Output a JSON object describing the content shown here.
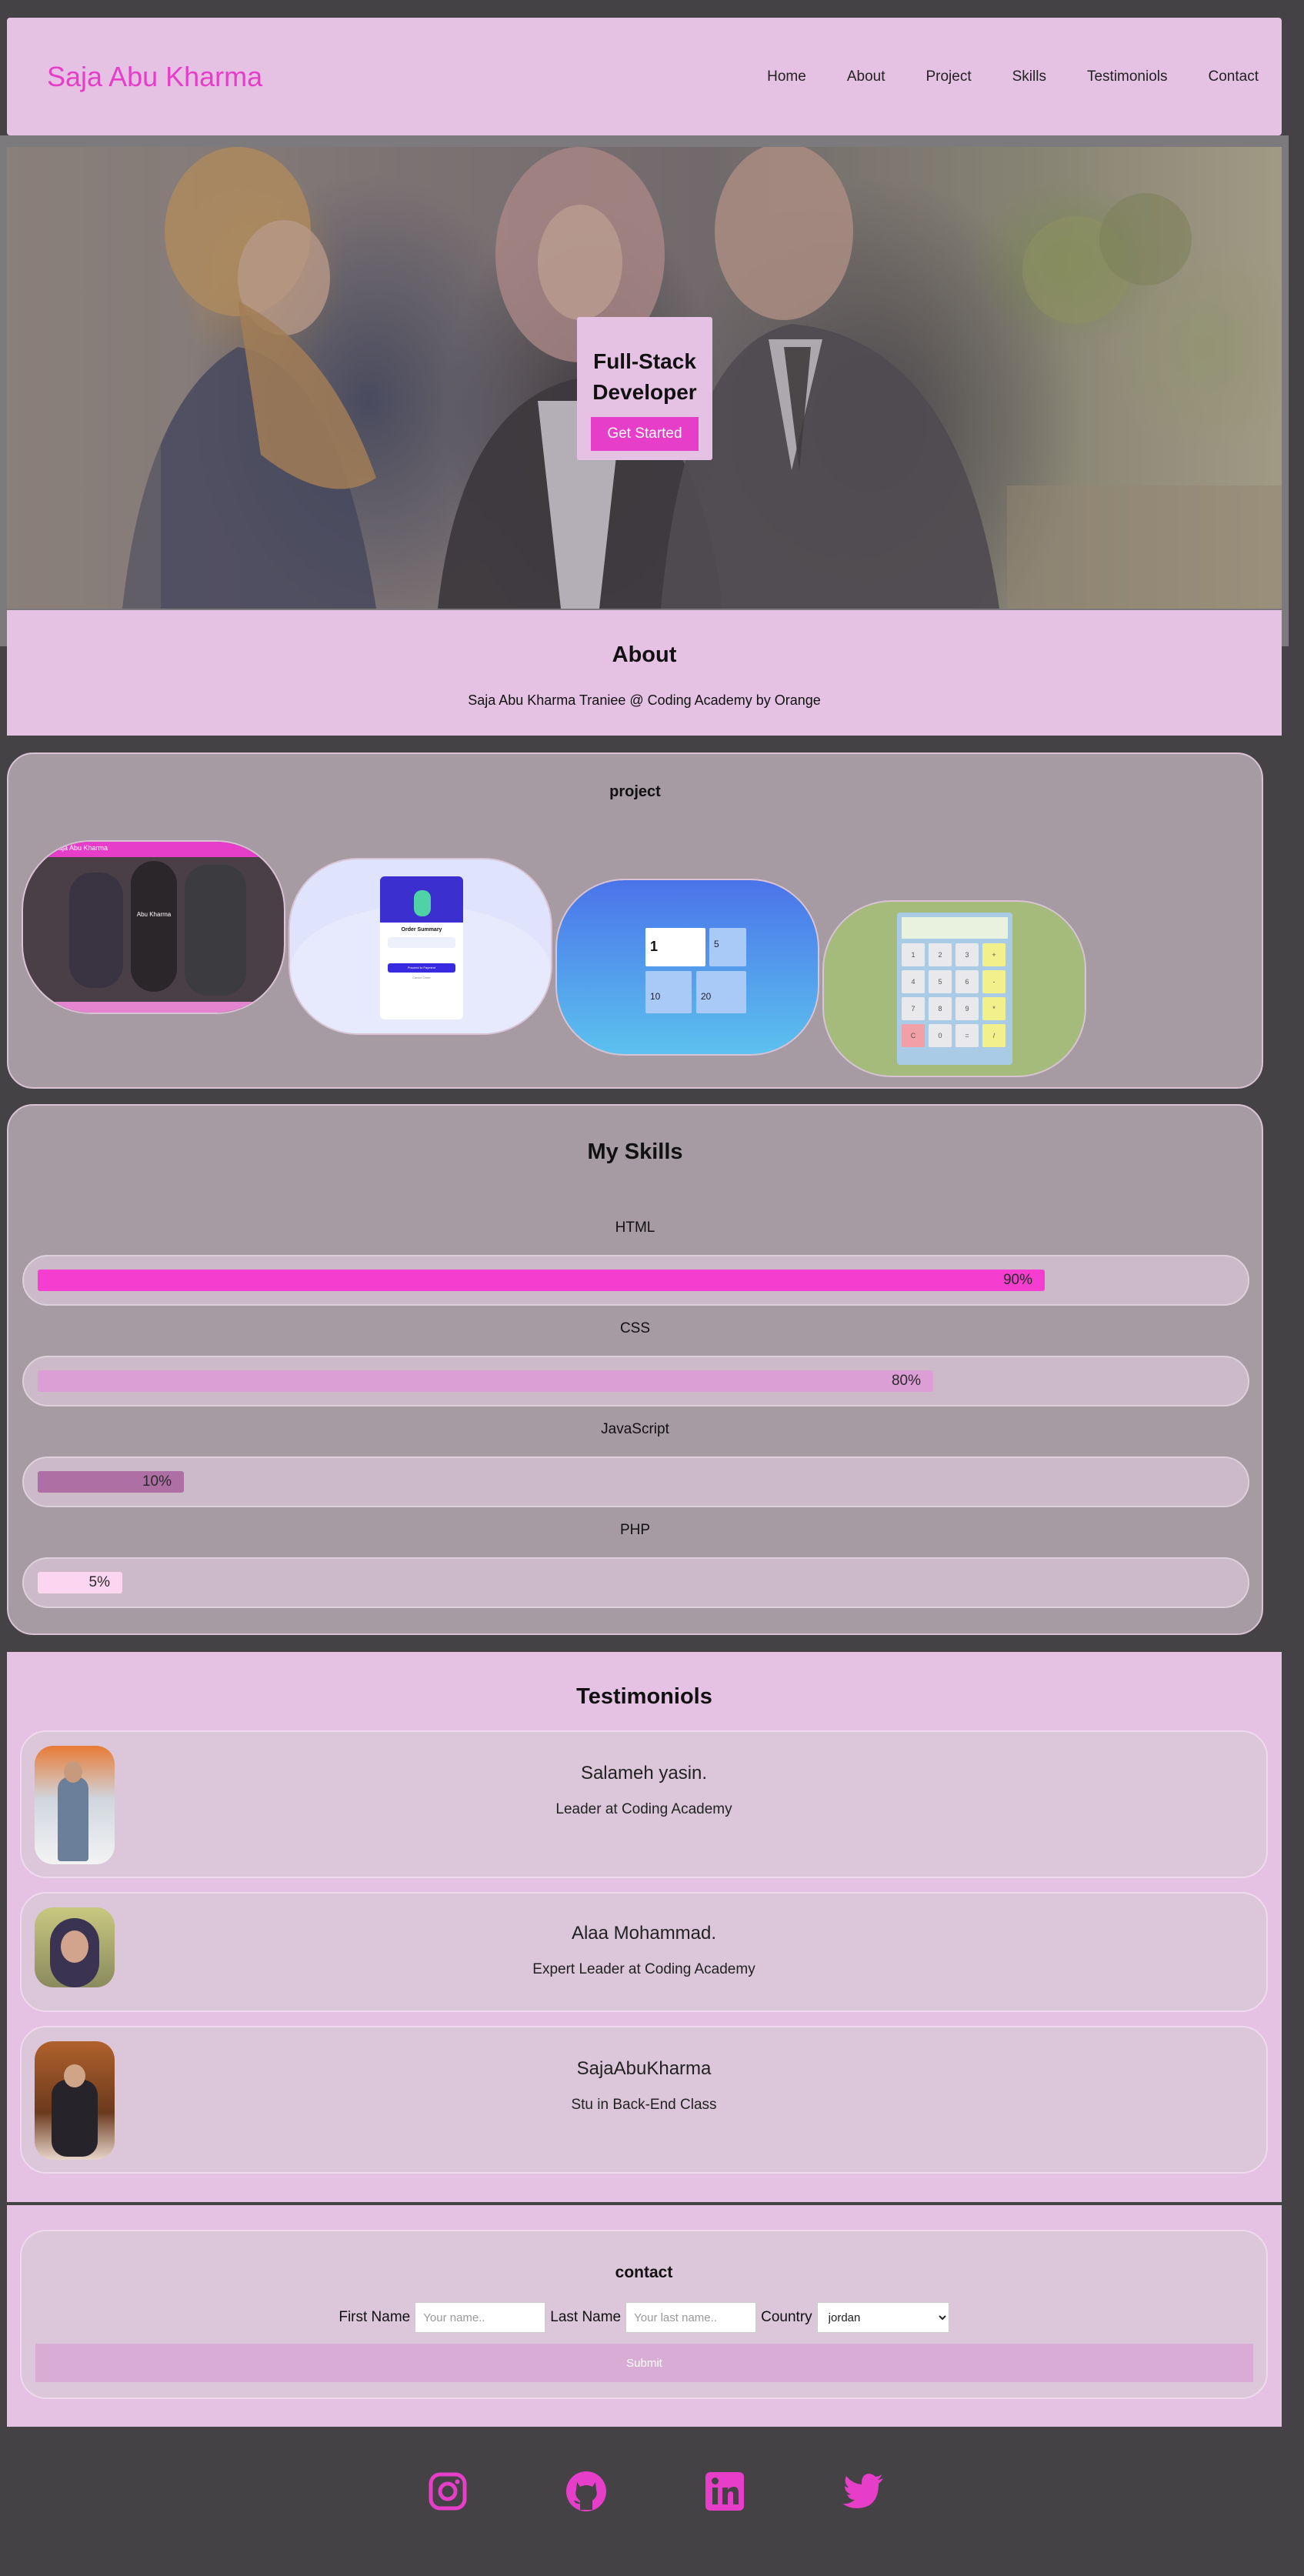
{
  "nav": {
    "brand": "Saja Abu Kharma",
    "links": [
      "Home",
      "About",
      "Project",
      "Skills",
      "Testimoniols",
      "Contact"
    ]
  },
  "hero": {
    "title_line1": "Full-Stack",
    "title_line2": "Developer",
    "cta": "Get Started"
  },
  "about": {
    "heading": "About",
    "text": "Saja Abu Kharma Traniee @ Coding Academy by Orange"
  },
  "project": {
    "heading": "project",
    "thumbs": [
      {
        "nav_brand": "Saja Abu Kharma",
        "hero_text": "Abu Kharma"
      },
      {
        "heading": "Order Summary",
        "button": "Proceed to Payment",
        "cancel": "Cancel Order"
      },
      {
        "tiles": [
          "1",
          "5",
          "10",
          "20"
        ]
      },
      {
        "keys": [
          "1",
          "2",
          "3",
          "+",
          "4",
          "5",
          "6",
          "-",
          "7",
          "8",
          "9",
          "*",
          "C",
          "0",
          "=",
          "/"
        ]
      }
    ]
  },
  "skills": {
    "heading": "My Skills",
    "items": [
      {
        "name": "HTML",
        "percent": 90,
        "label": "90%",
        "color": "#f53ecf"
      },
      {
        "name": "CSS",
        "percent": 80,
        "label": "80%",
        "color": "#dc9fd5"
      },
      {
        "name": "JavaScript",
        "percent": 10,
        "label": "10%",
        "color": "#ad6fa4"
      },
      {
        "name": "PHP",
        "percent": 5,
        "label": "5%",
        "color": "#fcd6f0"
      }
    ]
  },
  "testimonials": {
    "heading": "Testimoniols",
    "items": [
      {
        "name": "Salameh yasin.",
        "role": "Leader at Coding Academy"
      },
      {
        "name": "Alaa Mohammad.",
        "role": "Expert Leader at Coding Academy"
      },
      {
        "name": "SajaAbuKharma",
        "role": "Stu in Back-End Class"
      }
    ]
  },
  "contact": {
    "heading": "contact",
    "first_name_label": "First Name",
    "first_name_placeholder": "Your name..",
    "last_name_label": "Last Name",
    "last_name_placeholder": "Your last name..",
    "country_label": "Country",
    "country_value": "jordan",
    "submit": "Submit"
  },
  "footer": {
    "social": [
      "instagram-icon",
      "github-icon",
      "linkedin-icon",
      "twitter-icon"
    ]
  },
  "colors": {
    "accent": "#e63ec8",
    "nav_bg": "#e5c2e4",
    "panel_bg": "#a69aa3",
    "page_bg": "#444244"
  }
}
